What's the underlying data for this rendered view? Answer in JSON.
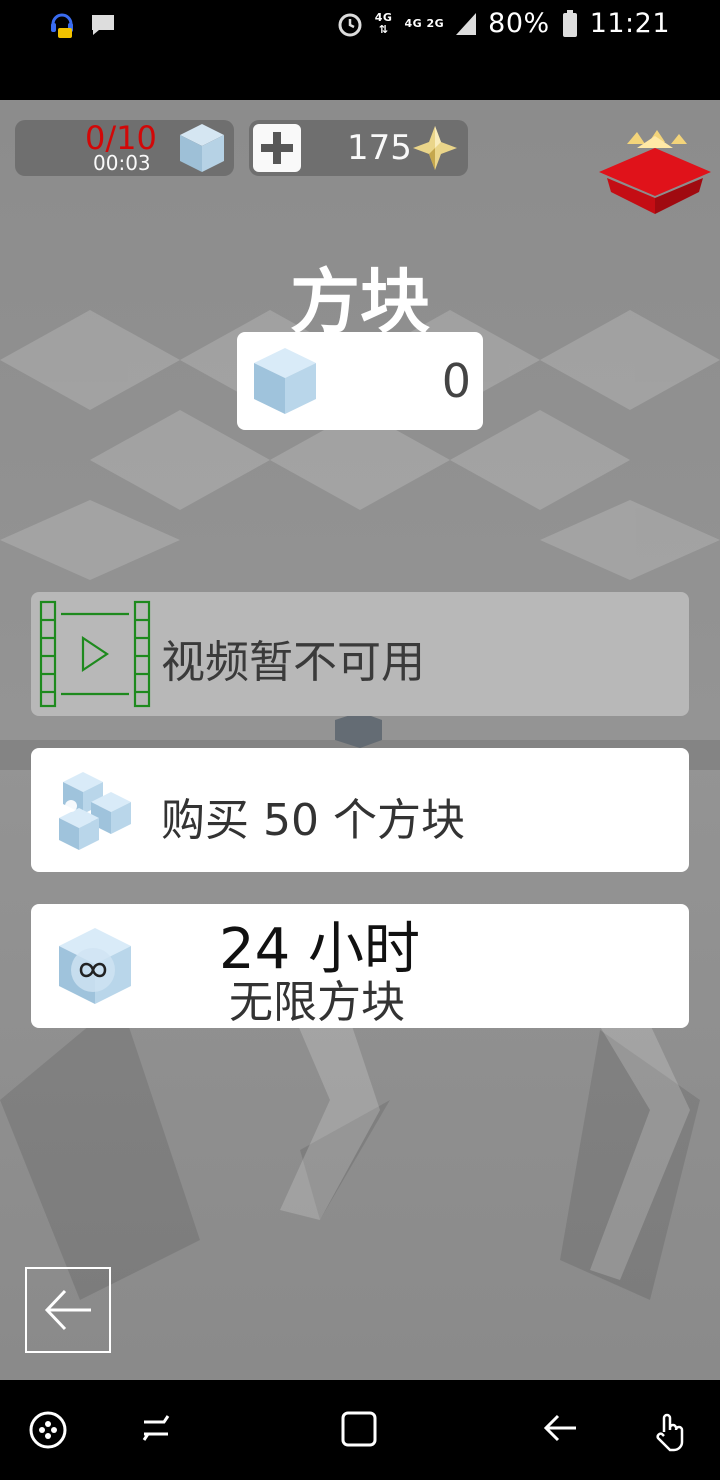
{
  "status_bar": {
    "battery": "80%",
    "time": "11:21",
    "network_top": "4G",
    "network_bottom": "4G 2G",
    "icons": [
      "headset-chat-icon",
      "message-icon",
      "alarm-icon",
      "signal-icon",
      "battery-icon"
    ]
  },
  "hud": {
    "level_progress": "0/10",
    "level_timer": "00:03",
    "gem_count": "175"
  },
  "title": "方块",
  "blocks_counter": {
    "value": "0"
  },
  "options": [
    {
      "label": "视频暂不可用",
      "icon": "video-play-icon",
      "enabled": false
    },
    {
      "label": "购买 50 个方块",
      "icon": "cubes-icon",
      "enabled": true
    },
    {
      "line1": "24 小时",
      "line2": "无限方块",
      "icon": "infinity-cube-icon",
      "enabled": true
    }
  ],
  "colors": {
    "level_red": "#d60000",
    "video_green": "#1e8a1e",
    "cube_blue": "#a8c8e2",
    "gift_red": "#e0121a"
  },
  "nav_bar": [
    "game-tools-icon",
    "recents-icon",
    "home-icon",
    "back-icon",
    "touch-icon"
  ]
}
